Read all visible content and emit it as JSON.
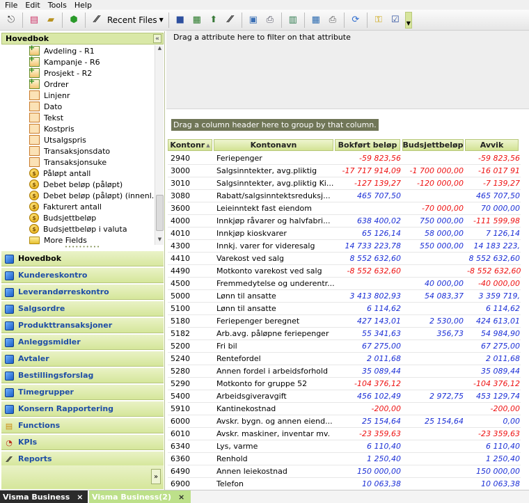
{
  "menu": [
    "File",
    "Edit",
    "Tools",
    "Help"
  ],
  "toolbar": {
    "recent_files_label": "Recent Files",
    "icons": [
      "exit-icon",
      "new-document-icon",
      "open-folder-icon",
      "refresh-green-icon",
      "visma-logo-icon",
      "save-icon",
      "excel-icon",
      "export-icon",
      "visma-logo-icon",
      "report-icon",
      "print-preview-icon",
      "print-icon",
      "calculator-icon",
      "printer-icon",
      "sync-icon",
      "key-icon",
      "checklist-icon"
    ]
  },
  "left": {
    "header": "Hovedbok",
    "tree": [
      {
        "label": "Avdeling - R1",
        "icon": "plus"
      },
      {
        "label": "Kampanje - R6",
        "icon": "plus"
      },
      {
        "label": "Prosjekt - R2",
        "icon": "plus"
      },
      {
        "label": "Ordrer",
        "icon": "plus"
      },
      {
        "label": "Linjenr",
        "icon": "grid"
      },
      {
        "label": "Dato",
        "icon": "grid"
      },
      {
        "label": "Tekst",
        "icon": "grid"
      },
      {
        "label": "Kostpris",
        "icon": "grid"
      },
      {
        "label": "Utsalgspris",
        "icon": "grid"
      },
      {
        "label": "Transaksjonsdato",
        "icon": "grid"
      },
      {
        "label": "Transaksjonsuke",
        "icon": "grid"
      },
      {
        "label": "Påløpt antall",
        "icon": "coin"
      },
      {
        "label": "Debet beløp (påløpt)",
        "icon": "coin"
      },
      {
        "label": "Debet beløp (påløpt) (innenl.)",
        "icon": "coin"
      },
      {
        "label": "Fakturert antall",
        "icon": "coin"
      },
      {
        "label": "Budsjettbeløp",
        "icon": "coin"
      },
      {
        "label": "Budsjettbeløp i valuta",
        "icon": "coin"
      },
      {
        "label": "More Fields",
        "icon": "folder"
      }
    ],
    "nav": [
      {
        "label": "Hovedbok",
        "icon": "cube",
        "active": true
      },
      {
        "label": "Kundereskontro",
        "icon": "cube"
      },
      {
        "label": "Leverandørreskontro",
        "icon": "cube"
      },
      {
        "label": "Salgsordre",
        "icon": "cube"
      },
      {
        "label": "Produkttransaksjoner",
        "icon": "cube"
      },
      {
        "label": "Anleggsmidler",
        "icon": "cube"
      },
      {
        "label": "Avtaler",
        "icon": "cube"
      },
      {
        "label": "Bestillingsforslag",
        "icon": "cube"
      },
      {
        "label": "Timegrupper",
        "icon": "cube"
      },
      {
        "label": "Konsern Rapportering",
        "icon": "cube"
      },
      {
        "label": "Functions",
        "icon": "functions"
      },
      {
        "label": "KPIs",
        "icon": "gauge"
      },
      {
        "label": "Reports",
        "icon": "reports"
      }
    ]
  },
  "filter_hint": "Drag a attribute here to filter on that attribute",
  "group_hint": "Drag a column header here to group by that column.",
  "columns": [
    "Kontonr",
    "Kontonavn",
    "Bokført beløp",
    "Budsjettbeløp",
    "Avvik"
  ],
  "rows": [
    [
      "2940",
      "Feriepenger",
      "-59 823,56",
      "",
      "-59 823,56"
    ],
    [
      "3000",
      "Salgsinntekter, avg.pliktig",
      "-17 717 914,09",
      "-1 700 000,00",
      "-16 017 91"
    ],
    [
      "3010",
      "Salgsinntekter, avg.pliktig Ki...",
      "-127 139,27",
      "-120 000,00",
      "-7 139,27"
    ],
    [
      "3080",
      "Rabatt/salgsinntektsreduksj...",
      "465 707,50",
      "",
      "465 707,50"
    ],
    [
      "3600",
      "Leieinntekt fast eiendom",
      "",
      "-70 000,00",
      "70 000,00"
    ],
    [
      "4000",
      "Innkjøp råvarer og halvfabri...",
      "638 400,02",
      "750 000,00",
      "-111 599,98"
    ],
    [
      "4010",
      "Innkjøp kioskvarer",
      "65 126,14",
      "58 000,00",
      "7 126,14"
    ],
    [
      "4300",
      "Innkj. varer for videresalg",
      "14 733 223,78",
      "550 000,00",
      "14 183 223,"
    ],
    [
      "4410",
      "Varekost ved salg",
      "8 552 632,60",
      "",
      "8 552 632,60"
    ],
    [
      "4490",
      "Motkonto varekost ved salg",
      "-8 552 632,60",
      "",
      "-8 552 632,60"
    ],
    [
      "4500",
      "Fremmedytelse og underentr...",
      "",
      "40 000,00",
      "-40 000,00"
    ],
    [
      "5000",
      "Lønn til ansatte",
      "3 413 802,93",
      "54 083,37",
      "3 359 719,"
    ],
    [
      "5100",
      "Lønn til ansatte",
      "6 114,62",
      "",
      "6 114,62"
    ],
    [
      "5180",
      "Feriepenger beregnet",
      "427 143,01",
      "2 530,00",
      "424 613,01"
    ],
    [
      "5182",
      "Arb.avg. påløpne feriepenger",
      "55 341,63",
      "356,73",
      "54 984,90"
    ],
    [
      "5200",
      "Fri bil",
      "67 275,00",
      "",
      "67 275,00"
    ],
    [
      "5240",
      "Rentefordel",
      "2 011,68",
      "",
      "2 011,68"
    ],
    [
      "5280",
      "Annen fordel i arbeidsforhold",
      "35 089,44",
      "",
      "35 089,44"
    ],
    [
      "5290",
      "Motkonto for gruppe 52",
      "-104 376,12",
      "",
      "-104 376,12"
    ],
    [
      "5400",
      "Arbeidsgiveravgift",
      "456 102,49",
      "2 972,75",
      "453 129,74"
    ],
    [
      "5910",
      "Kantinekostnad",
      "-200,00",
      "",
      "-200,00"
    ],
    [
      "6000",
      "Avskr. bygn. og annen eiend...",
      "25 154,64",
      "25 154,64",
      "0,00"
    ],
    [
      "6010",
      "Avskr. maskiner, inventar mv.",
      "-23 359,63",
      "",
      "-23 359,63"
    ],
    [
      "6340",
      "Lys, varme",
      "6 110,40",
      "",
      "6 110,40"
    ],
    [
      "6360",
      "Renhold",
      "1 250,40",
      "",
      "1 250,40"
    ],
    [
      "6490",
      "Annen leiekostnad",
      "150 000,00",
      "",
      "150 000,00"
    ],
    [
      "6900",
      "Telefon",
      "10 063,38",
      "",
      "10 063,38"
    ]
  ],
  "tabs": [
    {
      "label": "Visma Business",
      "close": "×"
    },
    {
      "label": "Visma Business(2)",
      "close": "×"
    }
  ],
  "colors": {
    "accent": "#d5e69a",
    "negative": "#e11111",
    "positive": "#1b2fd6",
    "nav_text": "#1f4ea6"
  }
}
